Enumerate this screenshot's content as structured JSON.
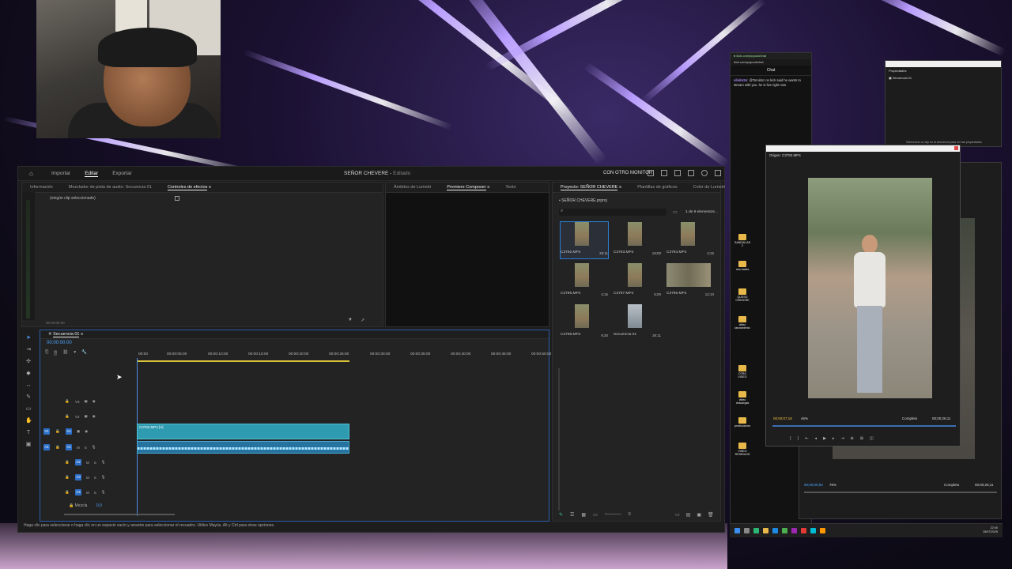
{
  "app": {
    "nav": [
      "Importar",
      "Editar",
      "Exportar"
    ],
    "active_nav": "Editar",
    "title_name": "SEÑOR CHEVERE",
    "title_status": "Editado",
    "monitor_label": "CON OTRO MONITOR"
  },
  "source_panel": {
    "tabs": [
      "Información",
      "Mezclador de pista de audio: Secuencia 01",
      "Controles de efectos"
    ],
    "active_tab": "Controles de efectos",
    "empty_text": "(ningún clip seleccionado)",
    "timecode": "00:00:00:00"
  },
  "program_panel": {
    "tabs": [
      "Ámbitos de Lumetri",
      "Premiere Composer",
      "Texto"
    ],
    "active_tab": "Premiere Composer"
  },
  "project_panel": {
    "tabs": [
      "Proyecto: SEÑOR CHEVERE",
      "Plantillas de gráficos",
      "Color de Lumetri"
    ],
    "file": "SEÑOR CHEVERE.prproj",
    "count": "1 de 8 elementos...",
    "items": [
      {
        "name": "C3792.MP4",
        "duration": "26:11",
        "selected": true
      },
      {
        "name": "C3793.MP4",
        "duration": "19;00"
      },
      {
        "name": "C3794.MP4",
        "duration": "4;15"
      },
      {
        "name": "C3795.MP4",
        "duration": "4;15"
      },
      {
        "name": "C3797.MP4",
        "duration": "5;00"
      },
      {
        "name": "C3796.MP4",
        "duration": "12;10"
      },
      {
        "name": "C3798.MP4",
        "duration": "9;30"
      },
      {
        "name": "Secuencia 01",
        "duration": "26:11"
      }
    ]
  },
  "timeline": {
    "tab": "Secuencia 01",
    "timecode": "00:00:00:00",
    "ruler": [
      "00:00",
      "00:00:05:00",
      "00:00:10:00",
      "00:00:15:00",
      "00:00:20:00",
      "00:00:25:00",
      "00:00:30:00",
      "00:00:35:00",
      "00:00:40:00",
      "00:00:45:00",
      "00:00:50:00"
    ],
    "tracks": [
      "V3",
      "V2",
      "V1",
      "A1",
      "A2",
      "A3",
      "A4"
    ],
    "clip_label": "C3792.MP4 [V]",
    "mix_label": "Mezcla",
    "mix_value": "0,0"
  },
  "status_bar": "Haga clic para seleccionar o haga clic en un espacio vacío y arrastre para seleccionar el recuadro. Utilice Mayús, Alt y Ctrl para otras opciones.",
  "chat": {
    "title": "Chat",
    "username": "silvitoSx",
    "message": "@Tomiitoz on kick said he wants to stream with you. he is live right now"
  },
  "desktop_icons": [
    "SANDALIAS 2",
    "reto bailes",
    "QUESO CHEVERE",
    "video lanzamiento",
    "OTRO VIDEO",
    "video descargas",
    "predicciones",
    "VIDEO RESIDUOS"
  ],
  "properties_window": {
    "title": "Propiedades",
    "item": "Secuencia 01",
    "hint": "Seleccione un clip en la secuencia para ver las propiedades."
  },
  "source_monitor": {
    "title": "Origen: C3792.MP4",
    "timecode_in": "00;00;07;18",
    "zoom": "46%",
    "fit": "Completo",
    "timecode_total": "00;00;26;11"
  },
  "program_monitor": {
    "timecode_in": "00;00;00;00",
    "zoom": "75%",
    "fit": "Completo",
    "timecode_total": "00;00;26;11"
  },
  "clock": {
    "time": "22:40",
    "date": "15/07/2025"
  }
}
